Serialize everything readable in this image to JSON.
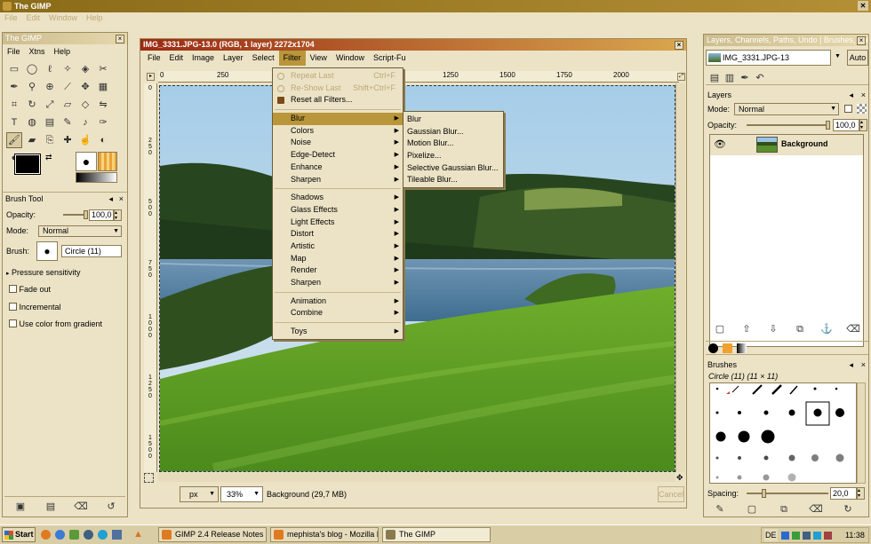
{
  "app": {
    "title": "The GIMP",
    "menu": [
      "File",
      "Edit",
      "Window",
      "Help"
    ]
  },
  "toolbox": {
    "title": "The GIMP",
    "menu": [
      "File",
      "Xtns",
      "Help"
    ]
  },
  "brush_tool": {
    "title": "Brush Tool",
    "opacity_label": "Opacity:",
    "opacity_value": "100,0",
    "opacity_fraction": 1.0,
    "mode_label": "Mode:",
    "mode_value": "Normal",
    "brush_label": "Brush:",
    "brush_value": "Circle (11)",
    "pressure_label": "Pressure sensitivity",
    "fade_label": "Fade out",
    "incremental_label": "Incremental",
    "gradient_label": "Use color from gradient"
  },
  "image_window": {
    "title": "IMG_3331.JPG-13.0 (RGB, 1 layer) 2272x1704",
    "menu": [
      "File",
      "Edit",
      "Image",
      "Layer",
      "Select",
      "Filter",
      "View",
      "Window",
      "Script-Fu"
    ],
    "ruler_ticks": [
      "0",
      "250",
      "500",
      "750",
      "1000",
      "1250",
      "1500",
      "1750",
      "2000"
    ],
    "unit": "px",
    "zoom": "33%",
    "status": "Background (29,7 MB)",
    "cancel_label": "Cancel"
  },
  "filter_menu": {
    "items": [
      {
        "label": "Repeat Last",
        "accel": "Ctrl+F",
        "disabled": true
      },
      {
        "label": "Re-Show Last",
        "accel": "Shift+Ctrl+F",
        "disabled": true
      },
      {
        "label": "Reset all Filters...",
        "accel": ""
      },
      {
        "label": "Blur",
        "submenu": true,
        "highlighted": true
      },
      {
        "label": "Colors",
        "submenu": true
      },
      {
        "label": "Noise",
        "submenu": true
      },
      {
        "label": "Edge-Detect",
        "submenu": true
      },
      {
        "label": "Enhance",
        "submenu": true
      },
      {
        "label": "Sharpen",
        "submenu": true
      },
      {
        "label": "Shadows",
        "submenu": true
      },
      {
        "label": "Glass Effects",
        "submenu": true
      },
      {
        "label": "Light Effects",
        "submenu": true
      },
      {
        "label": "Distort",
        "submenu": true
      },
      {
        "label": "Artistic",
        "submenu": true
      },
      {
        "label": "Map",
        "submenu": true
      },
      {
        "label": "Render",
        "submenu": true
      },
      {
        "label": "Sharpen",
        "submenu": true
      },
      {
        "label": "Animation",
        "submenu": true
      },
      {
        "label": "Combine",
        "submenu": true
      },
      {
        "label": "Toys",
        "submenu": true
      }
    ]
  },
  "blur_submenu": {
    "items": [
      "Blur",
      "Gaussian Blur...",
      "Motion Blur...",
      "Pixelize...",
      "Selective Gaussian Blur...",
      "Tileable Blur..."
    ]
  },
  "layers_dock": {
    "title": "Layers, Channels, Paths, Undo | Brushes, Pat...",
    "image_select": "IMG_3331.JPG-13",
    "auto_label": "Auto",
    "layers_title": "Layers",
    "mode_label": "Mode:",
    "mode_value": "Normal",
    "opacity_label": "Opacity:",
    "opacity_value": "100,0",
    "opacity_fraction": 1.0,
    "layer_name": "Background"
  },
  "brushes_dock": {
    "title": "Brushes",
    "selected": "Circle (11) (11 × 11)",
    "spacing_label": "Spacing:",
    "spacing_value": "20,0",
    "spacing_fraction": 0.2
  },
  "taskbar": {
    "start_label": "Start",
    "tasks": [
      "GIMP 2.4 Release Notes ...",
      "mephista's blog - Mozilla F...",
      "The GIMP"
    ],
    "lang": "DE",
    "clock": "11:38"
  }
}
